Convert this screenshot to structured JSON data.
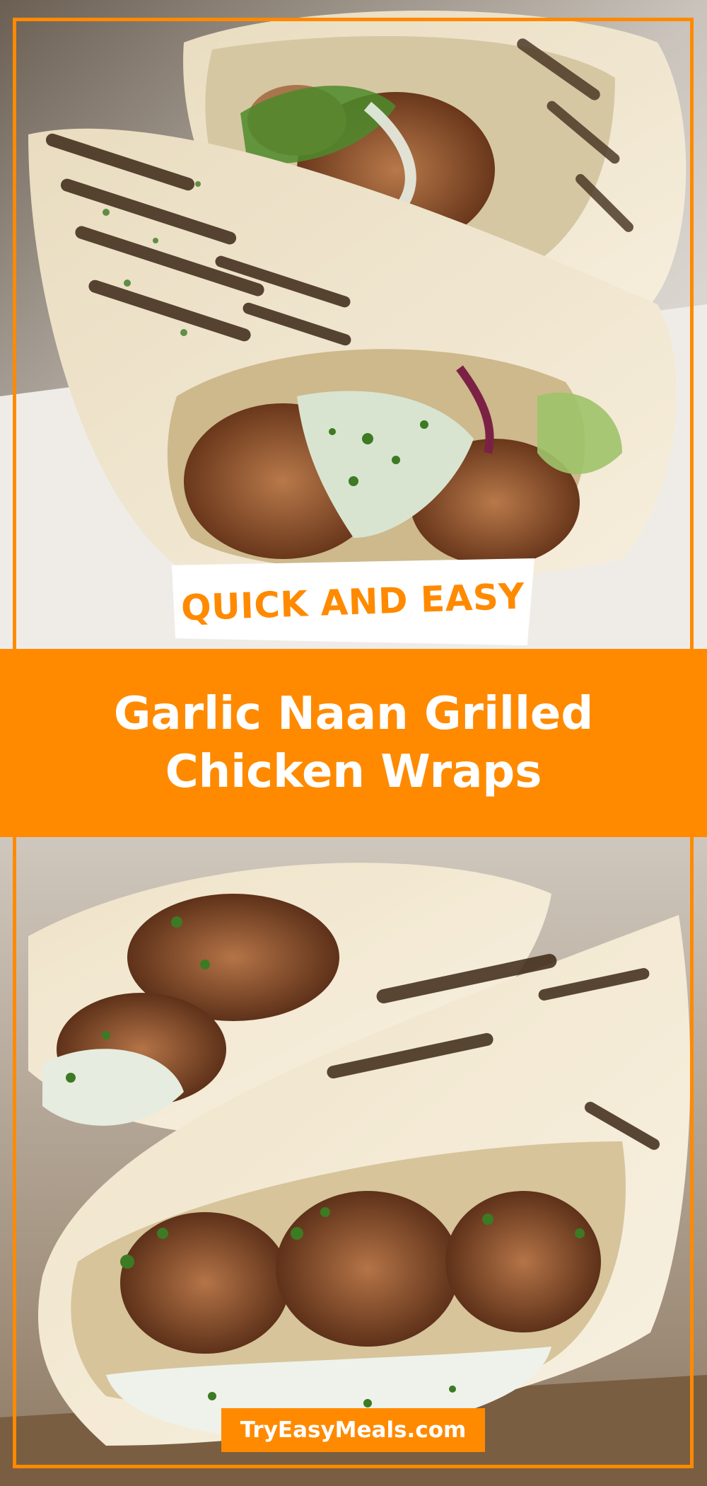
{
  "badge_top": {
    "text": "QUICK AND EASY"
  },
  "banner": {
    "line1": "Garlic Naan Grilled",
    "line2": "Chicken Wraps"
  },
  "footer_badge": {
    "text": "TryEasyMeals.com"
  },
  "colors": {
    "accent": "#ff8a00",
    "badge_bg": "#ffffff",
    "banner_text": "#ffffff"
  },
  "images": [
    {
      "name": "top-photo",
      "subject": "grilled chicken naan wraps, close-up"
    },
    {
      "name": "bottom-photo",
      "subject": "grilled chicken naan wrap with herbs and sauce"
    }
  ]
}
